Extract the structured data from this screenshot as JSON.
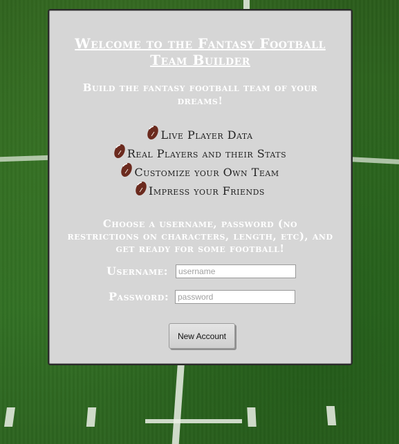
{
  "header": {
    "title": "Welcome to the Fantasy Football Team Builder",
    "subtitle": "Build the fantasy football team of your dreams!"
  },
  "features": [
    {
      "icon": "football-icon",
      "label": "Live Player Data"
    },
    {
      "icon": "football-icon",
      "label": "Real Players and their Stats"
    },
    {
      "icon": "football-icon",
      "label": "Customize your Own Team"
    },
    {
      "icon": "football-icon",
      "label": "Impress your Friends"
    }
  ],
  "form": {
    "instructions": "Choose a username, password (no restrictions on characters, length, etc), and get ready for some football!",
    "username_label": "Username:",
    "username_placeholder": "username",
    "username_value": "",
    "password_label": "Password:",
    "password_placeholder": "password",
    "password_value": "",
    "submit_label": "New Account"
  },
  "colors": {
    "panel_bg": "#d6d6d6",
    "heading_text": "#ffffff",
    "feature_text": "#222222",
    "field_green": "#2f6b22",
    "football_brown": "#6b2a1e"
  }
}
